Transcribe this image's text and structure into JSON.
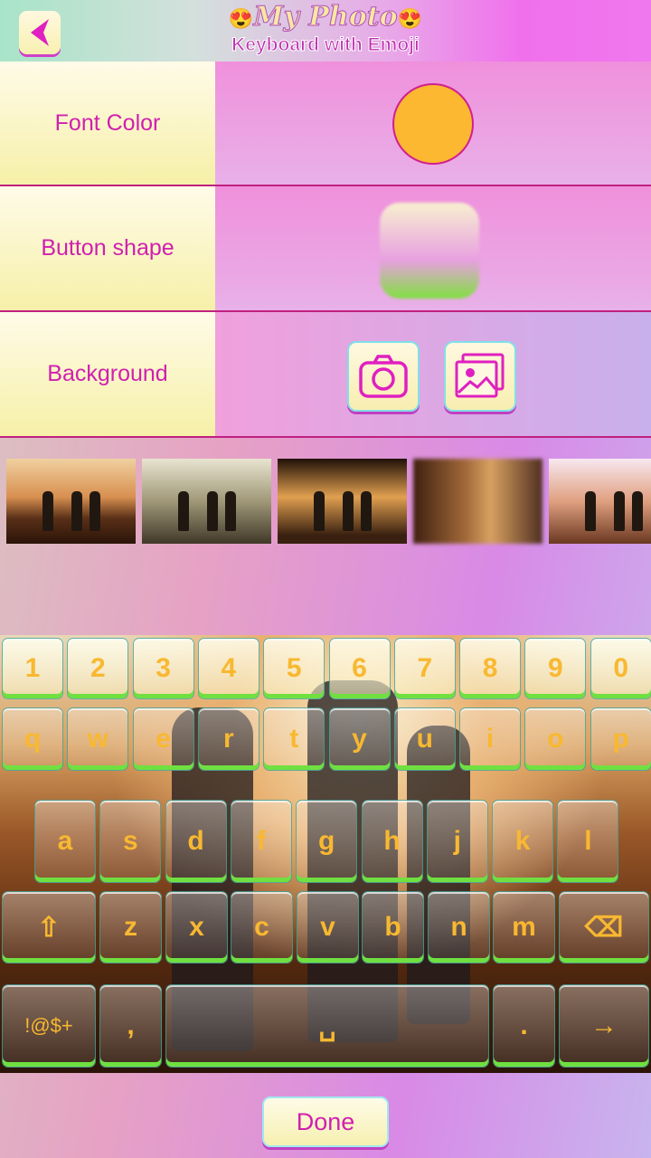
{
  "header": {
    "title_top": "My Photo",
    "title_bottom": "Keyboard with Emoji",
    "emoji": "😍"
  },
  "settings": [
    {
      "label": "Font Color",
      "value_color": "#fbb830"
    },
    {
      "label": "Button shape"
    },
    {
      "label": "Background"
    }
  ],
  "thumbnails": [
    "Original",
    "Faded",
    "Vignette",
    "Blur",
    "Light"
  ],
  "keyboard": {
    "row1": [
      "1",
      "2",
      "3",
      "4",
      "5",
      "6",
      "7",
      "8",
      "9",
      "0"
    ],
    "row2": [
      "q",
      "w",
      "e",
      "r",
      "t",
      "y",
      "u",
      "i",
      "o",
      "p"
    ],
    "row3": [
      "a",
      "s",
      "d",
      "f",
      "g",
      "h",
      "j",
      "k",
      "l"
    ],
    "row4": [
      "⇧",
      "z",
      "x",
      "c",
      "v",
      "b",
      "n",
      "m",
      "⌫"
    ],
    "row5": [
      "!@$+",
      ",",
      "␣",
      ".",
      "→"
    ],
    "font_color": "#f8b830"
  },
  "done_label": "Done"
}
